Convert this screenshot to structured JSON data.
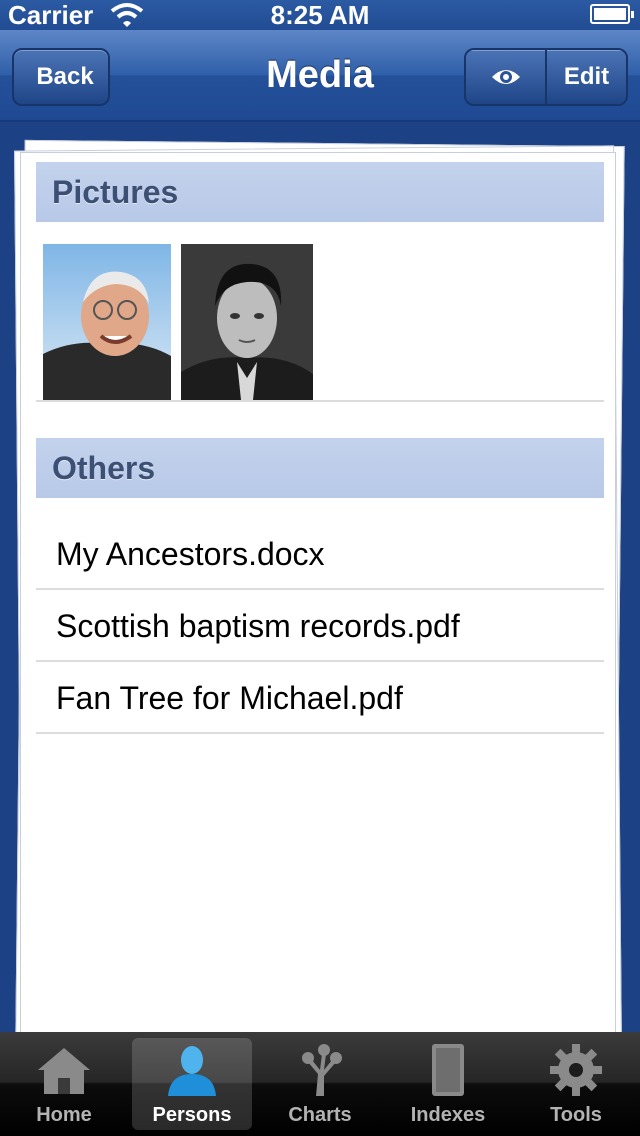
{
  "status_bar": {
    "carrier": "Carrier",
    "time": "8:25 AM"
  },
  "nav": {
    "back_label": "Back",
    "title": "Media",
    "view_icon": "eye-icon",
    "edit_label": "Edit"
  },
  "pictures": {
    "header": "Pictures",
    "items": [
      {
        "description_icon": "photo-thumbnail"
      },
      {
        "description_icon": "photo-thumbnail"
      }
    ]
  },
  "others": {
    "header": "Others",
    "items": [
      {
        "label": "My Ancestors.docx"
      },
      {
        "label": "Scottish baptism records.pdf"
      },
      {
        "label": "Fan Tree for Michael.pdf"
      }
    ]
  },
  "tabs": [
    {
      "label": "Home",
      "icon": "home-icon",
      "active": false
    },
    {
      "label": "Persons",
      "icon": "person-icon",
      "active": true
    },
    {
      "label": "Charts",
      "icon": "tree-icon",
      "active": false
    },
    {
      "label": "Indexes",
      "icon": "book-icon",
      "active": false
    },
    {
      "label": "Tools",
      "icon": "gear-icon",
      "active": false
    }
  ],
  "colors": {
    "nav_blue": "#2f5fa9",
    "section_header": "#c3d2ec",
    "section_text": "#3c4f74"
  }
}
